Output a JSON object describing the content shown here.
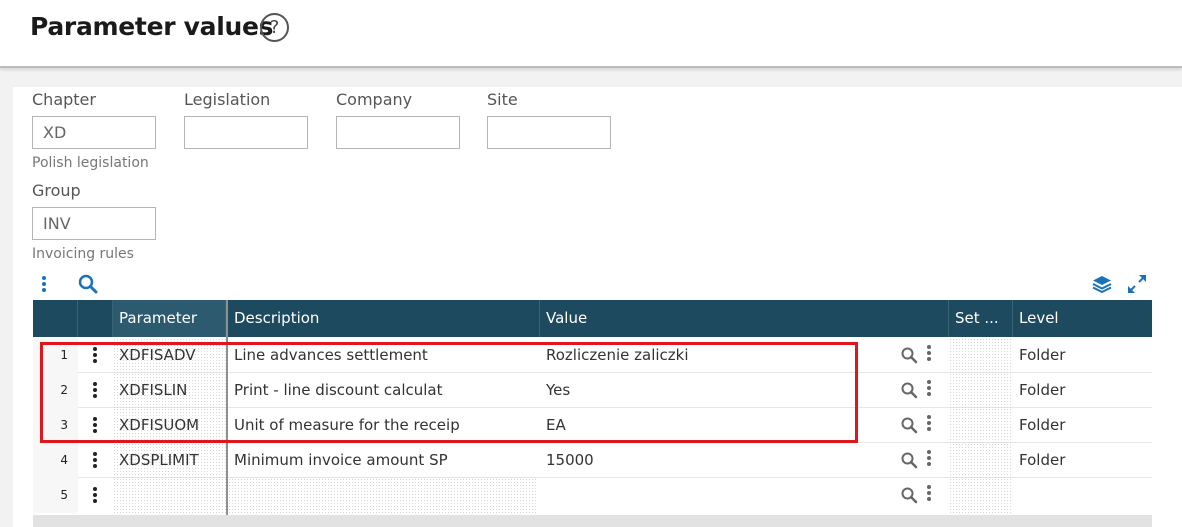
{
  "page": {
    "title": "Parameter values",
    "help_icon": "?"
  },
  "filters": {
    "chapter": {
      "label": "Chapter",
      "value": "XD",
      "description": "Polish legislation"
    },
    "legislation": {
      "label": "Legislation",
      "value": ""
    },
    "company": {
      "label": "Company",
      "value": ""
    },
    "site": {
      "label": "Site",
      "value": ""
    },
    "group": {
      "label": "Group",
      "value": "INV",
      "description": "Invoicing rules"
    }
  },
  "grid": {
    "columns": {
      "parameter": "Parameter",
      "description": "Description",
      "value": "Value",
      "set": "Set ...",
      "level": "Level"
    },
    "rows": [
      {
        "num": "1",
        "parameter": "XDFISADV",
        "description": "Line advances settlement",
        "value": "Rozliczenie zaliczki",
        "level": "Folder"
      },
      {
        "num": "2",
        "parameter": "XDFISLIN",
        "description": "Print - line discount calculat",
        "value": "Yes",
        "level": "Folder"
      },
      {
        "num": "3",
        "parameter": "XDFISUOM",
        "description": "Unit of measure for the receip",
        "value": "EA",
        "level": "Folder"
      },
      {
        "num": "4",
        "parameter": "XDSPLIMIT",
        "description": "Minimum invoice amount SP",
        "value": "15000",
        "level": "Folder"
      },
      {
        "num": "5",
        "parameter": "",
        "description": "",
        "value": "",
        "level": ""
      }
    ]
  },
  "colors": {
    "header_bg": "#1d4a5f",
    "accent": "#1a73b8",
    "highlight": "#e0161e"
  },
  "icons": {
    "toolbar_left": [
      "more-vertical-icon",
      "search-icon"
    ],
    "toolbar_right": [
      "layers-icon",
      "expand-icon"
    ],
    "row": [
      "row-menu-icon",
      "zoom-icon",
      "value-actions-icon"
    ]
  }
}
